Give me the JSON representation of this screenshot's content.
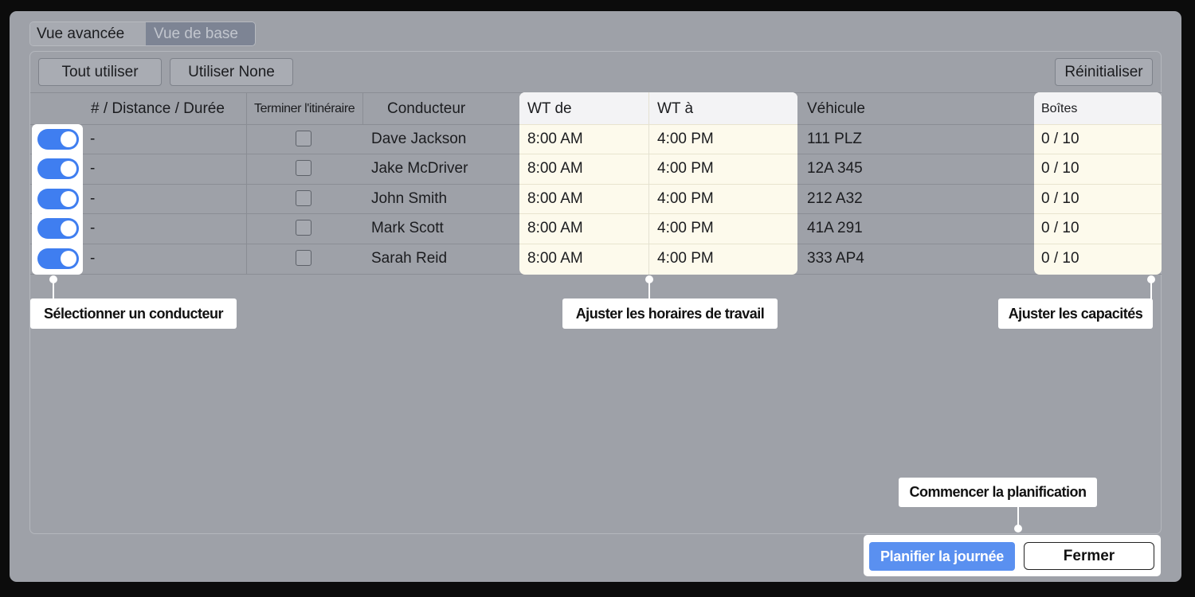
{
  "view_tabs": {
    "advanced": "Vue avancée",
    "basic": "Vue de base",
    "active": "basic"
  },
  "toolbar": {
    "use_all": "Tout utiliser",
    "use_none": "Utiliser None",
    "reset": "Réinitialiser"
  },
  "table": {
    "headers": {
      "distance": "# / Distance / Durée",
      "finish_route": "Terminer l'itinéraire",
      "driver": "Conducteur",
      "wt_from": "WT de",
      "wt_to": "WT à",
      "vehicle": "Véhicule",
      "boxes": "Boîtes"
    },
    "rows": [
      {
        "enabled": true,
        "distance": "-",
        "finish": false,
        "driver": "Dave Jackson",
        "wt_from": "8:00 AM",
        "wt_to": "4:00 PM",
        "vehicle": "111 PLZ",
        "boxes": "0 / 10"
      },
      {
        "enabled": true,
        "distance": "-",
        "finish": false,
        "driver": "Jake McDriver",
        "wt_from": "8:00 AM",
        "wt_to": "4:00 PM",
        "vehicle": "12A 345",
        "boxes": "0 / 10"
      },
      {
        "enabled": true,
        "distance": "-",
        "finish": false,
        "driver": "John Smith",
        "wt_from": "8:00 AM",
        "wt_to": "4:00 PM",
        "vehicle": "212 A32",
        "boxes": "0 / 10"
      },
      {
        "enabled": true,
        "distance": "-",
        "finish": false,
        "driver": "Mark Scott",
        "wt_from": "8:00 AM",
        "wt_to": "4:00 PM",
        "vehicle": "41A 291",
        "boxes": "0 / 10"
      },
      {
        "enabled": true,
        "distance": "-",
        "finish": false,
        "driver": "Sarah Reid",
        "wt_from": "8:00 AM",
        "wt_to": "4:00 PM",
        "vehicle": "333 AP4",
        "boxes": "0 / 10"
      }
    ]
  },
  "callouts": {
    "select_driver": "Sélectionner un conducteur",
    "adjust_hours": "Ajuster les horaires de travail",
    "adjust_capacity": "Ajuster les capacités",
    "start_planning": "Commencer la planification"
  },
  "footer": {
    "plan_day": "Planifier la journée",
    "close": "Fermer"
  },
  "colors": {
    "accent": "#3f7ef0",
    "plan_button": "#5a90f0",
    "highlight": "#fdfaec",
    "window": "#9ea1a8"
  }
}
